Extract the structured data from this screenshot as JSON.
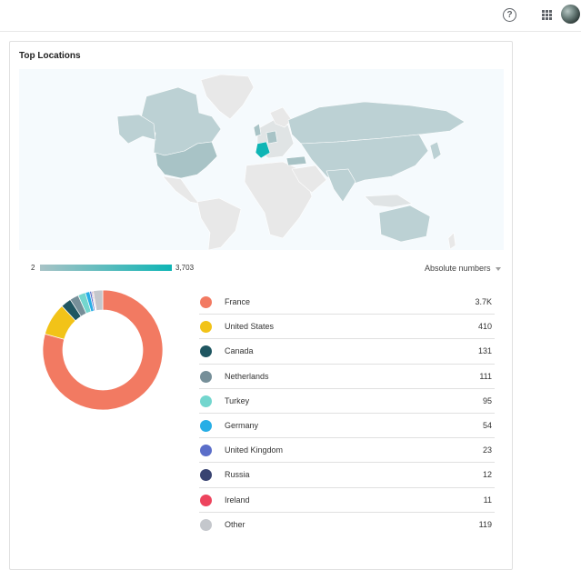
{
  "header": {
    "icons": [
      "help-icon",
      "apps-grid-icon",
      "avatar"
    ]
  },
  "card": {
    "title": "Top Locations"
  },
  "map": {
    "scale_min": "2",
    "scale_max": "3,703",
    "colors": {
      "background": "#f5fafd",
      "land": "#e8e8e8",
      "low": "#a8c3c6",
      "high": "#0eb5b5"
    }
  },
  "metric_select": {
    "label": "Absolute numbers"
  },
  "locations": [
    {
      "name": "France",
      "value": "3.7K",
      "count": 3703,
      "color": "#f27a62"
    },
    {
      "name": "United States",
      "value": "410",
      "count": 410,
      "color": "#f2c318"
    },
    {
      "name": "Canada",
      "value": "131",
      "count": 131,
      "color": "#1f5661"
    },
    {
      "name": "Netherlands",
      "value": "111",
      "count": 111,
      "color": "#768f99"
    },
    {
      "name": "Turkey",
      "value": "95",
      "count": 95,
      "color": "#73d6ce"
    },
    {
      "name": "Germany",
      "value": "54",
      "count": 54,
      "color": "#27aee6"
    },
    {
      "name": "United Kingdom",
      "value": "23",
      "count": 23,
      "color": "#5b6ec9"
    },
    {
      "name": "Russia",
      "value": "12",
      "count": 12,
      "color": "#384371"
    },
    {
      "name": "Ireland",
      "value": "11",
      "count": 11,
      "color": "#ed445d"
    },
    {
      "name": "Other",
      "value": "119",
      "count": 119,
      "color": "#c4c7cc"
    }
  ]
}
